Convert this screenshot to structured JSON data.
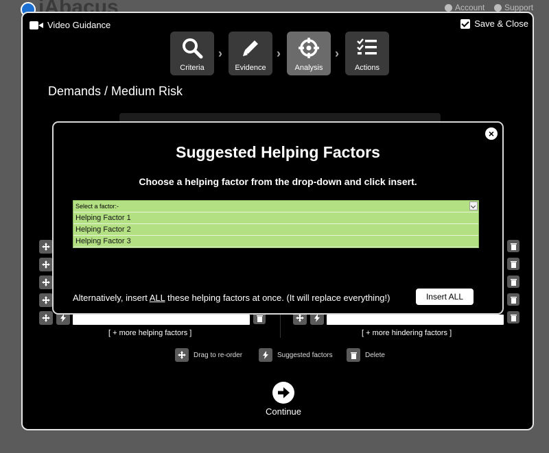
{
  "app": {
    "title": "iAbacus",
    "account": "Account",
    "support": "Support"
  },
  "window": {
    "video_guidance": "Video Guidance",
    "save_close": "Save & Close",
    "steps": [
      {
        "label": "Criteria",
        "icon": "search-icon"
      },
      {
        "label": "Evidence",
        "icon": "pencil-icon"
      },
      {
        "label": "Analysis",
        "icon": "crosshair-icon",
        "active": true
      },
      {
        "label": "Actions",
        "icon": "checklist-icon"
      }
    ],
    "heading": "Demands / Medium Risk",
    "more_helping": "[ + more helping factors ]",
    "more_hindering": "[ + more hindering factors ]",
    "legend": {
      "drag": "Drag to re-order",
      "suggested": "Suggested factors",
      "delete": "Delete"
    },
    "continue": "Continue"
  },
  "modal": {
    "title": "Suggested Helping Factors",
    "subtitle": "Choose a helping factor from the drop-down and click insert.",
    "select_placeholder": "Select a factor:-",
    "options": [
      "Helping Factor 1",
      "Helping Factor 2",
      "Helping Factor 3"
    ],
    "alt_before": "Alternatively, insert ",
    "alt_all": "ALL",
    "alt_after": " these helping factors at once. (It will replace everything!)",
    "insert_all": "Insert ALL"
  },
  "colors": {
    "select_bg": "#b3e083",
    "active_step": "#6b6b6b",
    "step": "#3a3a3a"
  }
}
